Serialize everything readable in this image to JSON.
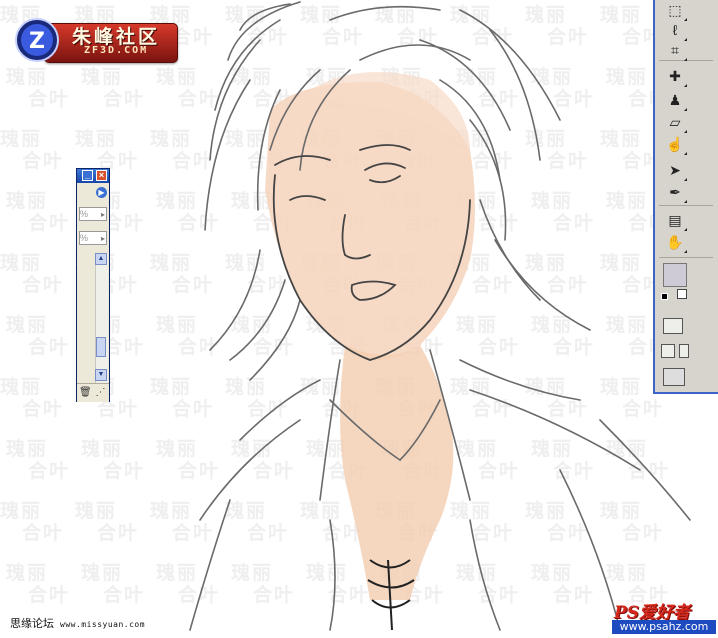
{
  "logo": {
    "title": "朱峰社区",
    "subtitle": "ZF3D.COM",
    "badge_letter": "Z"
  },
  "watermark": {
    "line1": "瑰丽",
    "line2": "合叶"
  },
  "left_palette": {
    "field1": "%",
    "field2": "%"
  },
  "toolbox": {
    "tools": [
      "marquee-icon",
      "lasso-icon",
      "crop-icon",
      "healing-brush-icon",
      "clone-stamp-icon",
      "eraser-icon",
      "smudge-icon",
      "path-selection-icon",
      "pen-icon",
      "notes-icon",
      "hand-icon",
      "quick-mask-icon",
      "screen-mode-icon",
      "jump-to-imageready-icon"
    ],
    "foreground_color": "#cfcbd6",
    "background_color": "#ffffff"
  },
  "footer": {
    "left_text": "思缘论坛",
    "left_url": "www.missyuan.com",
    "right_logo": "PS爱好者",
    "right_url": "www.psahz.com"
  },
  "colors": {
    "toolbox_border": "#3a64c8",
    "skin": "#f3cdb0",
    "sketch_line": "#5a5a5a"
  }
}
